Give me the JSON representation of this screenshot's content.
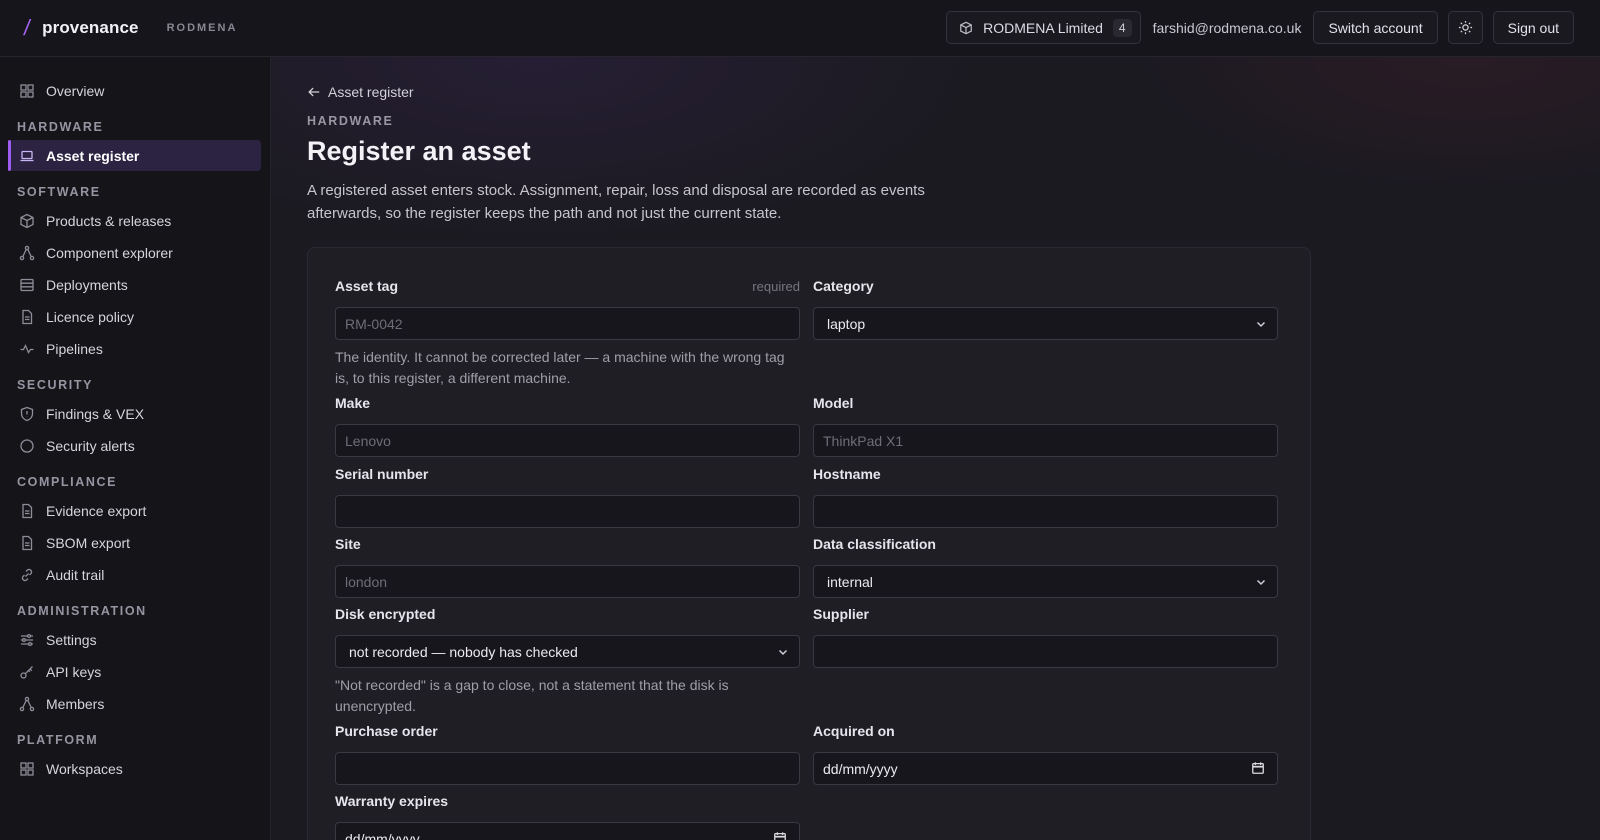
{
  "brand": {
    "name": "provenance",
    "org": "RODMENA"
  },
  "header": {
    "org_name": "RODMENA Limited",
    "org_count": "4",
    "email": "farshid@rodmena.co.uk",
    "switch_account": "Switch account",
    "sign_out": "Sign out"
  },
  "sidebar": {
    "overview": "Overview",
    "sections": {
      "hardware": "HARDWARE",
      "software": "SOFTWARE",
      "security": "SECURITY",
      "compliance": "COMPLIANCE",
      "administration": "ADMINISTRATION",
      "platform": "PLATFORM"
    },
    "items": {
      "asset_register": "Asset register",
      "products_releases": "Products & releases",
      "component_explorer": "Component explorer",
      "deployments": "Deployments",
      "licence_policy": "Licence policy",
      "pipelines": "Pipelines",
      "findings_vex": "Findings & VEX",
      "security_alerts": "Security alerts",
      "evidence_export": "Evidence export",
      "sbom_export": "SBOM export",
      "audit_trail": "Audit trail",
      "settings": "Settings",
      "api_keys": "API keys",
      "members": "Members",
      "workspaces": "Workspaces"
    }
  },
  "page": {
    "back_link": "Asset register",
    "eyebrow": "HARDWARE",
    "title": "Register an asset",
    "description": "A registered asset enters stock. Assignment, repair, loss and disposal are recorded as events afterwards, so the register keeps the path and not just the current state."
  },
  "form": {
    "asset_tag": {
      "label": "Asset tag",
      "required": "required",
      "placeholder": "RM-0042",
      "hint": "The identity. It cannot be corrected later — a machine with the wrong tag is, to this register, a different machine."
    },
    "category": {
      "label": "Category",
      "value": "laptop"
    },
    "make": {
      "label": "Make",
      "placeholder": "Lenovo"
    },
    "model": {
      "label": "Model",
      "placeholder": "ThinkPad X1"
    },
    "serial_number": {
      "label": "Serial number",
      "value": ""
    },
    "hostname": {
      "label": "Hostname",
      "value": ""
    },
    "site": {
      "label": "Site",
      "placeholder": "london"
    },
    "data_classification": {
      "label": "Data classification",
      "value": "internal"
    },
    "disk_encrypted": {
      "label": "Disk encrypted",
      "value": "not recorded — nobody has checked",
      "hint": "\"Not recorded\" is a gap to close, not a statement that the disk is unencrypted."
    },
    "supplier": {
      "label": "Supplier",
      "value": ""
    },
    "purchase_order": {
      "label": "Purchase order",
      "value": ""
    },
    "acquired_on": {
      "label": "Acquired on",
      "placeholder": "dd/mm/yyyy"
    },
    "warranty_expires": {
      "label": "Warranty expires",
      "placeholder": "dd/mm/yyyy"
    }
  },
  "colors": {
    "accent": "#9f5cf0",
    "background": "#1b1a21",
    "sidebar": "#151419"
  }
}
